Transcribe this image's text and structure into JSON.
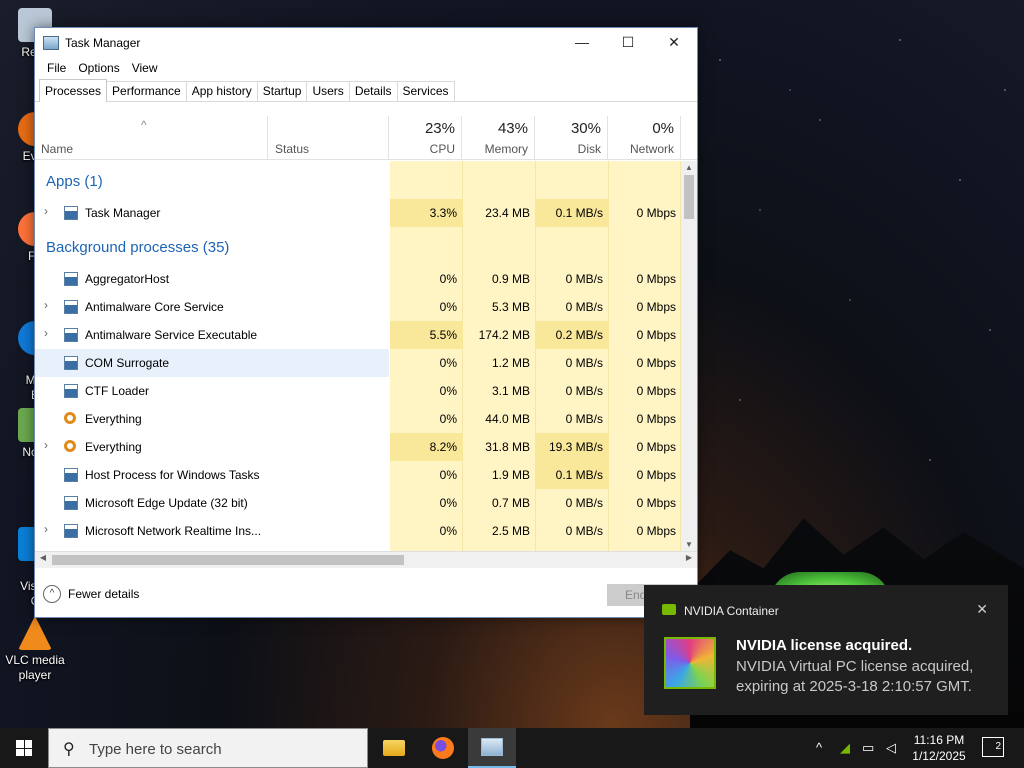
{
  "desktop": {
    "icons": [
      {
        "label": "Recy",
        "color": "#b9c7d6"
      },
      {
        "label": "Ever",
        "color": "#e76b13"
      },
      {
        "label": "Fir",
        "color": "#ff7139"
      },
      {
        "label": "Mic\nE",
        "color": "#0f7ad8"
      },
      {
        "label": "Note",
        "color": "#6aa84f"
      },
      {
        "label": "Visua\nC",
        "color": "#0b7fd6"
      },
      {
        "label": "VLC media player",
        "color": "#f08a1a"
      }
    ]
  },
  "window": {
    "title": "Task Manager",
    "minimize": "—",
    "maximize": "☐",
    "close": "✕",
    "menu": [
      "File",
      "Options",
      "View"
    ],
    "tabs": [
      "Processes",
      "Performance",
      "App history",
      "Startup",
      "Users",
      "Details",
      "Services"
    ],
    "active_tab": "Processes"
  },
  "columns": {
    "name": "Name",
    "status": "Status",
    "cpu": {
      "pct": "23%",
      "label": "CPU"
    },
    "memory": {
      "pct": "43%",
      "label": "Memory"
    },
    "disk": {
      "pct": "30%",
      "label": "Disk"
    },
    "network": {
      "pct": "0%",
      "label": "Network"
    }
  },
  "groups": {
    "apps": "Apps (1)",
    "background": "Background processes (35)"
  },
  "apps": [
    {
      "name": "Task Manager",
      "cpu": "3.3%",
      "memory": "23.4 MB",
      "disk": "0.1 MB/s",
      "network": "0 Mbps",
      "expandable": true,
      "icon": "task-manager-icon"
    }
  ],
  "background": [
    {
      "name": "AggregatorHost",
      "cpu": "0%",
      "memory": "0.9 MB",
      "disk": "0 MB/s",
      "network": "0 Mbps",
      "expandable": false,
      "icon": "process-window-icon"
    },
    {
      "name": "Antimalware Core Service",
      "cpu": "0%",
      "memory": "5.3 MB",
      "disk": "0 MB/s",
      "network": "0 Mbps",
      "expandable": true,
      "icon": "process-window-icon"
    },
    {
      "name": "Antimalware Service Executable",
      "cpu": "5.5%",
      "memory": "174.2 MB",
      "disk": "0.2 MB/s",
      "network": "0 Mbps",
      "expandable": true,
      "icon": "process-window-icon"
    },
    {
      "name": "COM Surrogate",
      "cpu": "0%",
      "memory": "1.2 MB",
      "disk": "0 MB/s",
      "network": "0 Mbps",
      "expandable": false,
      "icon": "process-window-icon"
    },
    {
      "name": "CTF Loader",
      "cpu": "0%",
      "memory": "3.1 MB",
      "disk": "0 MB/s",
      "network": "0 Mbps",
      "expandable": false,
      "icon": "ctf-loader-icon"
    },
    {
      "name": "Everything",
      "cpu": "0%",
      "memory": "44.0 MB",
      "disk": "0 MB/s",
      "network": "0 Mbps",
      "expandable": false,
      "icon": "everything-search-icon"
    },
    {
      "name": "Everything",
      "cpu": "8.2%",
      "memory": "31.8 MB",
      "disk": "19.3 MB/s",
      "network": "0 Mbps",
      "expandable": true,
      "icon": "everything-search-icon"
    },
    {
      "name": "Host Process for Windows Tasks",
      "cpu": "0%",
      "memory": "1.9 MB",
      "disk": "0.1 MB/s",
      "network": "0 Mbps",
      "expandable": false,
      "icon": "process-window-icon"
    },
    {
      "name": "Microsoft Edge Update (32 bit)",
      "cpu": "0%",
      "memory": "0.7 MB",
      "disk": "0 MB/s",
      "network": "0 Mbps",
      "expandable": false,
      "icon": "edge-update-icon"
    },
    {
      "name": "Microsoft Network Realtime Ins...",
      "cpu": "0%",
      "memory": "2.5 MB",
      "disk": "0 MB/s",
      "network": "0 Mbps",
      "expandable": true,
      "icon": "process-window-icon"
    }
  ],
  "footer": {
    "fewer_details": "Fewer details",
    "end_task": "End"
  },
  "toast": {
    "source": "NVIDIA Container",
    "close": "✕",
    "headline": "NVIDIA license acquired.",
    "body": "NVIDIA Virtual PC license acquired, expiring at 2025-3-18 2:10:57 GMT."
  },
  "taskbar": {
    "search_placeholder": "Type here to search",
    "time": "11:16 PM",
    "date": "1/12/2025",
    "notification_count": "2"
  }
}
